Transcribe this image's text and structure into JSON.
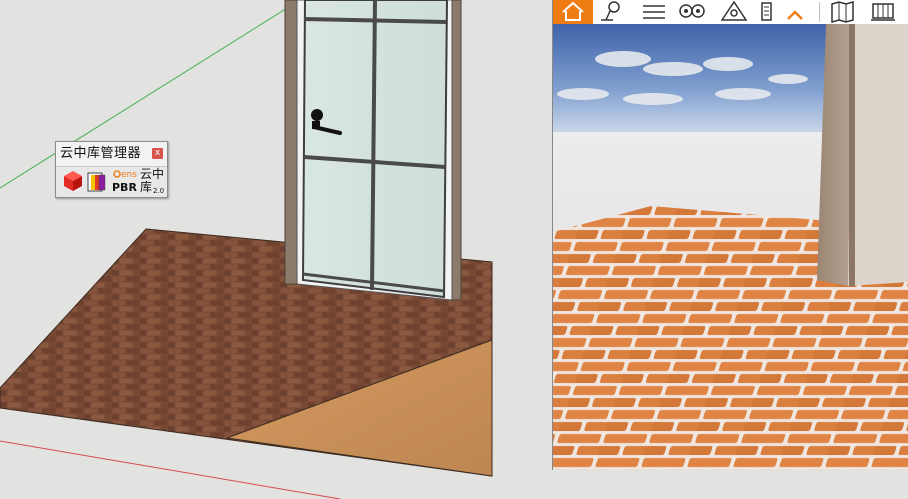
{
  "app": {
    "library_panel": {
      "title": "云中库管理器",
      "close_glyph": "x",
      "tools": [
        {
          "icon": "red-cube-icon",
          "label": ""
        },
        {
          "icon": "material-book-icon",
          "label": ""
        },
        {
          "icon": "enscape-pbr-icon",
          "label_top": "ens",
          "label_bottom": "PBR"
        },
        {
          "icon": "cloud-library-icon",
          "label_top": "云中",
          "label_bottom": "库",
          "version": "2.0"
        }
      ]
    },
    "render_window": {
      "toolbar": [
        {
          "name": "home",
          "icon": "home-icon",
          "active": true
        },
        {
          "name": "location",
          "icon": "map-pin-icon",
          "active": false
        },
        {
          "name": "menu",
          "icon": "hamburger-menu-icon",
          "active": false
        },
        {
          "name": "views",
          "icon": "binoculars-icon",
          "active": false
        },
        {
          "name": "sun",
          "icon": "sun-triangle-icon",
          "active": false
        },
        {
          "name": "buildings",
          "icon": "building-icon",
          "active": false
        },
        {
          "name": "collapse",
          "icon": "chevron-up-icon",
          "active": false
        },
        {
          "name": "map",
          "icon": "map-book-icon",
          "active": false
        },
        {
          "name": "library",
          "icon": "asset-library-icon",
          "active": false
        }
      ]
    },
    "colors": {
      "accent_orange": "#f07c14",
      "modeler_background": "#e2e2e0",
      "brick_floor": "#7a4b36",
      "wood_floor": "#c8905a",
      "render_brick": "#d77c3c"
    }
  }
}
